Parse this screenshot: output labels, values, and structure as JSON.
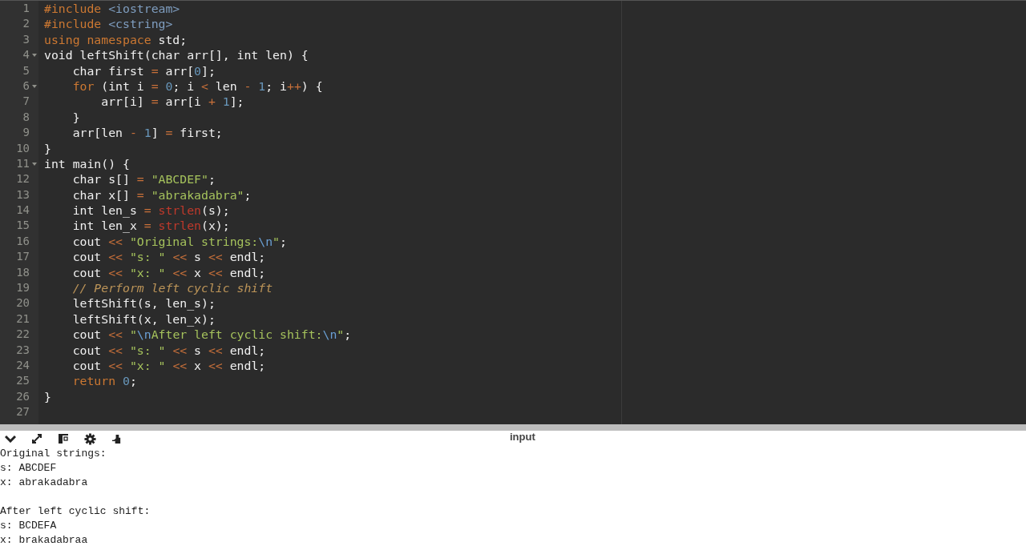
{
  "editor": {
    "lines": [
      {
        "number": "1",
        "fold": false,
        "tokens": [
          {
            "kind": "keyword",
            "text": "#include"
          },
          {
            "kind": "header",
            "text": " <iostream>"
          }
        ]
      },
      {
        "number": "2",
        "fold": false,
        "tokens": [
          {
            "kind": "keyword",
            "text": "#include"
          },
          {
            "kind": "header",
            "text": " <cstring>"
          }
        ]
      },
      {
        "number": "3",
        "fold": false,
        "tokens": [
          {
            "kind": "keyword",
            "text": "using namespace"
          },
          {
            "kind": "plain",
            "text": " std;"
          }
        ]
      },
      {
        "number": "4",
        "fold": true,
        "tokens": [
          {
            "kind": "plain",
            "text": "void leftShift(char arr[], int len) {"
          }
        ]
      },
      {
        "number": "5",
        "fold": false,
        "tokens": [
          {
            "kind": "plain",
            "text": "    char first "
          },
          {
            "kind": "operator",
            "text": "="
          },
          {
            "kind": "plain",
            "text": " arr["
          },
          {
            "kind": "number",
            "text": "0"
          },
          {
            "kind": "plain",
            "text": "];"
          }
        ]
      },
      {
        "number": "6",
        "fold": true,
        "tokens": [
          {
            "kind": "keyword",
            "text": "    for"
          },
          {
            "kind": "plain",
            "text": " (int i "
          },
          {
            "kind": "operator",
            "text": "="
          },
          {
            "kind": "number",
            "text": " 0"
          },
          {
            "kind": "plain",
            "text": "; i "
          },
          {
            "kind": "operator",
            "text": "<"
          },
          {
            "kind": "plain",
            "text": " len "
          },
          {
            "kind": "operator",
            "text": "-"
          },
          {
            "kind": "number",
            "text": " 1"
          },
          {
            "kind": "plain",
            "text": "; i"
          },
          {
            "kind": "operator",
            "text": "++"
          },
          {
            "kind": "plain",
            "text": ") {"
          }
        ]
      },
      {
        "number": "7",
        "fold": false,
        "tokens": [
          {
            "kind": "plain",
            "text": "        arr[i] "
          },
          {
            "kind": "operator",
            "text": "="
          },
          {
            "kind": "plain",
            "text": " arr[i "
          },
          {
            "kind": "operator",
            "text": "+"
          },
          {
            "kind": "number",
            "text": " 1"
          },
          {
            "kind": "plain",
            "text": "];"
          }
        ]
      },
      {
        "number": "8",
        "fold": false,
        "tokens": [
          {
            "kind": "plain",
            "text": "    }"
          }
        ]
      },
      {
        "number": "9",
        "fold": false,
        "tokens": [
          {
            "kind": "plain",
            "text": "    arr[len "
          },
          {
            "kind": "operator",
            "text": "-"
          },
          {
            "kind": "number",
            "text": " 1"
          },
          {
            "kind": "plain",
            "text": "] "
          },
          {
            "kind": "operator",
            "text": "="
          },
          {
            "kind": "plain",
            "text": " first;"
          }
        ]
      },
      {
        "number": "10",
        "fold": false,
        "tokens": [
          {
            "kind": "plain",
            "text": "}"
          }
        ]
      },
      {
        "number": "11",
        "fold": true,
        "tokens": [
          {
            "kind": "plain",
            "text": "int main() {"
          }
        ]
      },
      {
        "number": "12",
        "fold": false,
        "tokens": [
          {
            "kind": "plain",
            "text": "    char s[] "
          },
          {
            "kind": "operator",
            "text": "="
          },
          {
            "kind": "string",
            "text": " \"ABCDEF\""
          },
          {
            "kind": "plain",
            "text": ";"
          }
        ]
      },
      {
        "number": "13",
        "fold": false,
        "tokens": [
          {
            "kind": "plain",
            "text": "    char x[] "
          },
          {
            "kind": "operator",
            "text": "="
          },
          {
            "kind": "string",
            "text": " \"abrakadabra\""
          },
          {
            "kind": "plain",
            "text": ";"
          }
        ]
      },
      {
        "number": "14",
        "fold": false,
        "tokens": [
          {
            "kind": "plain",
            "text": "    int len_s "
          },
          {
            "kind": "operator",
            "text": "="
          },
          {
            "kind": "builtin",
            "text": " strlen"
          },
          {
            "kind": "plain",
            "text": "(s);"
          }
        ]
      },
      {
        "number": "15",
        "fold": false,
        "tokens": [
          {
            "kind": "plain",
            "text": "    int len_x "
          },
          {
            "kind": "operator",
            "text": "="
          },
          {
            "kind": "builtin",
            "text": " strlen"
          },
          {
            "kind": "plain",
            "text": "(x);"
          }
        ]
      },
      {
        "number": "16",
        "fold": false,
        "tokens": [
          {
            "kind": "plain",
            "text": "    cout "
          },
          {
            "kind": "operator",
            "text": "<<"
          },
          {
            "kind": "string",
            "text": " \"Original strings:"
          },
          {
            "kind": "escape",
            "text": "\\n"
          },
          {
            "kind": "string",
            "text": "\""
          },
          {
            "kind": "plain",
            "text": ";"
          }
        ]
      },
      {
        "number": "17",
        "fold": false,
        "tokens": [
          {
            "kind": "plain",
            "text": "    cout "
          },
          {
            "kind": "operator",
            "text": "<<"
          },
          {
            "kind": "string",
            "text": " \"s: \""
          },
          {
            "kind": "operator",
            "text": " <<"
          },
          {
            "kind": "plain",
            "text": " s "
          },
          {
            "kind": "operator",
            "text": "<<"
          },
          {
            "kind": "plain",
            "text": " endl;"
          }
        ]
      },
      {
        "number": "18",
        "fold": false,
        "tokens": [
          {
            "kind": "plain",
            "text": "    cout "
          },
          {
            "kind": "operator",
            "text": "<<"
          },
          {
            "kind": "string",
            "text": " \"x: \""
          },
          {
            "kind": "operator",
            "text": " <<"
          },
          {
            "kind": "plain",
            "text": " x "
          },
          {
            "kind": "operator",
            "text": "<<"
          },
          {
            "kind": "plain",
            "text": " endl;"
          }
        ]
      },
      {
        "number": "19",
        "fold": false,
        "tokens": [
          {
            "kind": "comment",
            "text": "    // Perform left cyclic shift"
          }
        ]
      },
      {
        "number": "20",
        "fold": false,
        "tokens": [
          {
            "kind": "plain",
            "text": "    leftShift(s, len_s);"
          }
        ]
      },
      {
        "number": "21",
        "fold": false,
        "tokens": [
          {
            "kind": "plain",
            "text": "    leftShift(x, len_x);"
          }
        ]
      },
      {
        "number": "22",
        "fold": false,
        "tokens": [
          {
            "kind": "plain",
            "text": "    cout "
          },
          {
            "kind": "operator",
            "text": "<<"
          },
          {
            "kind": "string",
            "text": " \""
          },
          {
            "kind": "escape",
            "text": "\\n"
          },
          {
            "kind": "string",
            "text": "After left cyclic shift:"
          },
          {
            "kind": "escape",
            "text": "\\n"
          },
          {
            "kind": "string",
            "text": "\""
          },
          {
            "kind": "plain",
            "text": ";"
          }
        ]
      },
      {
        "number": "23",
        "fold": false,
        "tokens": [
          {
            "kind": "plain",
            "text": "    cout "
          },
          {
            "kind": "operator",
            "text": "<<"
          },
          {
            "kind": "string",
            "text": " \"s: \""
          },
          {
            "kind": "operator",
            "text": " <<"
          },
          {
            "kind": "plain",
            "text": " s "
          },
          {
            "kind": "operator",
            "text": "<<"
          },
          {
            "kind": "plain",
            "text": " endl;"
          }
        ]
      },
      {
        "number": "24",
        "fold": false,
        "tokens": [
          {
            "kind": "plain",
            "text": "    cout "
          },
          {
            "kind": "operator",
            "text": "<<"
          },
          {
            "kind": "string",
            "text": " \"x: \""
          },
          {
            "kind": "operator",
            "text": " <<"
          },
          {
            "kind": "plain",
            "text": " x "
          },
          {
            "kind": "operator",
            "text": "<<"
          },
          {
            "kind": "plain",
            "text": " endl;"
          }
        ]
      },
      {
        "number": "25",
        "fold": false,
        "tokens": [
          {
            "kind": "keyword",
            "text": "    return"
          },
          {
            "kind": "number",
            "text": " 0"
          },
          {
            "kind": "plain",
            "text": ";"
          }
        ]
      },
      {
        "number": "26",
        "fold": false,
        "tokens": [
          {
            "kind": "plain",
            "text": "}"
          }
        ]
      },
      {
        "number": "27",
        "fold": false
      }
    ]
  },
  "output_panel": {
    "label": "input",
    "output": "Original strings:\ns: ABCDEF\nx: abrakadabra\n\nAfter left cyclic shift:\ns: BCDEFA\nx: brakadabraa"
  }
}
